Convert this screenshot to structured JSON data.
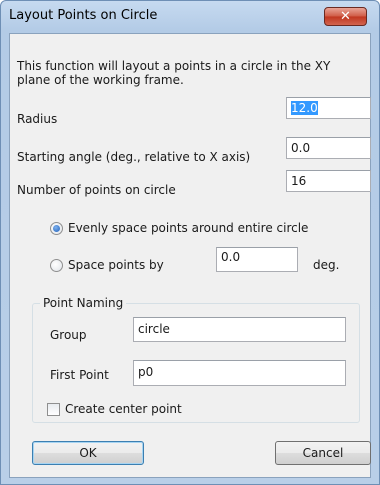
{
  "window": {
    "title": "Layout Points on Circle",
    "close_glyph": "✕"
  },
  "description": "This function will layout a points in a circle in the XY plane of the working frame.",
  "fields": {
    "radius": {
      "label": "Radius",
      "value": "12.0"
    },
    "starting_angle": {
      "label": "Starting angle (deg., relative to X axis)",
      "value": "0.0"
    },
    "num_points": {
      "label": "Number of points on circle",
      "value": "16"
    }
  },
  "spacing": {
    "option_even": {
      "label": "Evenly space points around entire circle",
      "checked": true
    },
    "option_by": {
      "label": "Space points by",
      "value": "0.0",
      "unit": "deg.",
      "checked": false
    }
  },
  "point_naming": {
    "title": "Point Naming",
    "group": {
      "label": "Group",
      "value": "circle"
    },
    "first_point": {
      "label": "First Point",
      "value": "p0"
    }
  },
  "create_center": {
    "label": "Create center point",
    "checked": false
  },
  "buttons": {
    "ok": "OK",
    "cancel": "Cancel"
  },
  "colors": {
    "selection": "#3399ff",
    "close_button": "#c0351f",
    "frame": "#b9cfe8"
  }
}
